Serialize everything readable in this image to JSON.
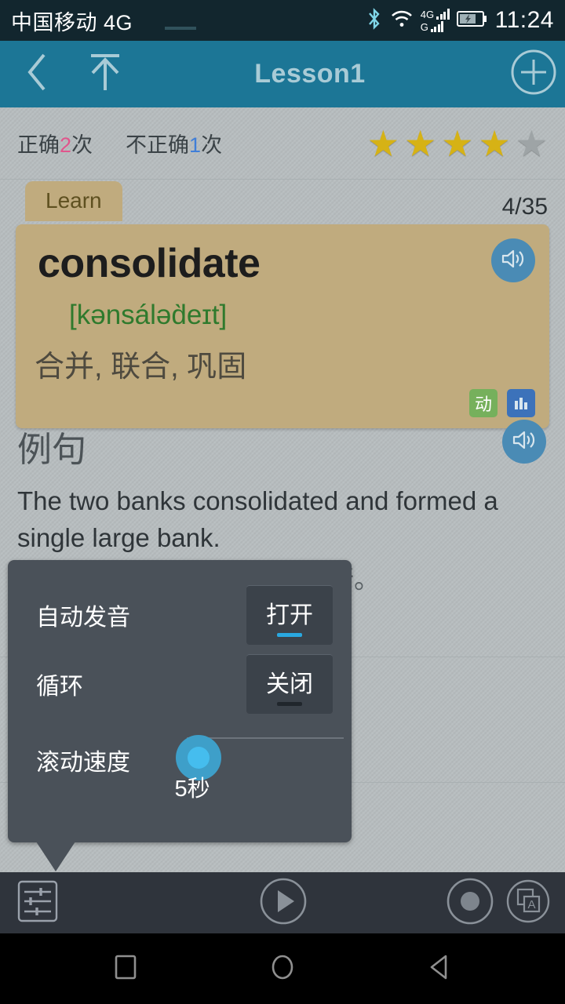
{
  "status_bar": {
    "carrier": "中国移动 4G",
    "network_primary": "4G",
    "network_secondary": "G",
    "clock": "11:24",
    "icons": [
      "bluetooth-icon",
      "wifi-icon",
      "signal-icon",
      "battery-charging-icon"
    ]
  },
  "app_bar": {
    "title": "Lesson1",
    "back_icon": "chevron-left-icon",
    "top_icon": "arrow-to-top-icon",
    "add_icon": "plus-circle-icon",
    "background": "#1c7696",
    "title_color": "#a9cbd6"
  },
  "stats": {
    "correct_prefix": "正确",
    "correct_count": "2",
    "correct_suffix": "次",
    "wrong_prefix": "不正确",
    "wrong_count": "1",
    "wrong_suffix": "次",
    "correct_color": "#e0568c",
    "wrong_color": "#3f7ed8",
    "stars_filled": 4,
    "stars_total": 5,
    "star_glyph": "★"
  },
  "card": {
    "tab_label": "Learn",
    "counter": "4/35",
    "word": "consolidate",
    "phonetic": "[kənsáləd̀eɪt]",
    "meaning": "合并, 联合, 巩固",
    "pos_tag": "动",
    "level_tag": "⎪⎪",
    "speaker_icon": "speaker-icon",
    "card_color": "#c0ab7e"
  },
  "example": {
    "title": "例句",
    "speaker_icon": "speaker-icon",
    "sentence_en": "The two banks consolidated and formed a single large bank.",
    "sentence_zh": "这两家银行合并成一家大银行。"
  },
  "popup": {
    "rows": [
      {
        "label": "自动发音",
        "control": "toggle",
        "value": "打开",
        "state": "on"
      },
      {
        "label": "循环",
        "control": "toggle",
        "value": "关闭",
        "state": "off"
      },
      {
        "label": "滚动速度",
        "control": "slider",
        "value": "5秒",
        "position_percent": 0
      }
    ],
    "background": "#4a5159",
    "accent": "#29a8e0"
  },
  "toolbar": {
    "settings_icon": "sliders-settings-icon",
    "play_icon": "play-icon",
    "record_icon": "record-icon",
    "translate_icon": "translate-card-icon"
  },
  "nav_bar": {
    "recents_icon": "square-recents-icon",
    "home_icon": "circle-home-icon",
    "back_icon": "triangle-back-icon"
  }
}
